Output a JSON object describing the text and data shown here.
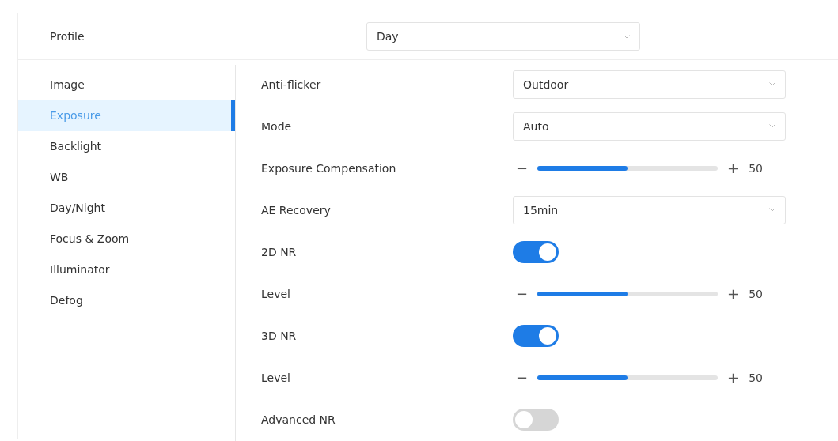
{
  "profile": {
    "label": "Profile",
    "value": "Day"
  },
  "sidebar": {
    "items": [
      {
        "label": "Image",
        "selected": false
      },
      {
        "label": "Exposure",
        "selected": true
      },
      {
        "label": "Backlight",
        "selected": false
      },
      {
        "label": "WB",
        "selected": false
      },
      {
        "label": "Day/Night",
        "selected": false
      },
      {
        "label": "Focus & Zoom",
        "selected": false
      },
      {
        "label": "Illuminator",
        "selected": false
      },
      {
        "label": "Defog",
        "selected": false
      }
    ]
  },
  "settings": [
    {
      "kind": "select",
      "label": "Anti-flicker",
      "value": "Outdoor"
    },
    {
      "kind": "select",
      "label": "Mode",
      "value": "Auto"
    },
    {
      "kind": "slider",
      "label": "Exposure Compensation",
      "minus": "−",
      "plus": "+",
      "level": 0.5,
      "reading": "50"
    },
    {
      "kind": "select",
      "label": "AE Recovery",
      "value": "15min"
    },
    {
      "kind": "toggle",
      "label": "2D NR",
      "on": true
    },
    {
      "kind": "slider",
      "label": "Level",
      "minus": "−",
      "plus": "+",
      "level": 0.5,
      "reading": "50"
    },
    {
      "kind": "toggle",
      "label": "3D NR",
      "on": true
    },
    {
      "kind": "slider",
      "label": "Level",
      "minus": "−",
      "plus": "+",
      "level": 0.5,
      "reading": "50"
    },
    {
      "kind": "toggle",
      "label": "Advanced NR",
      "on": false
    }
  ]
}
